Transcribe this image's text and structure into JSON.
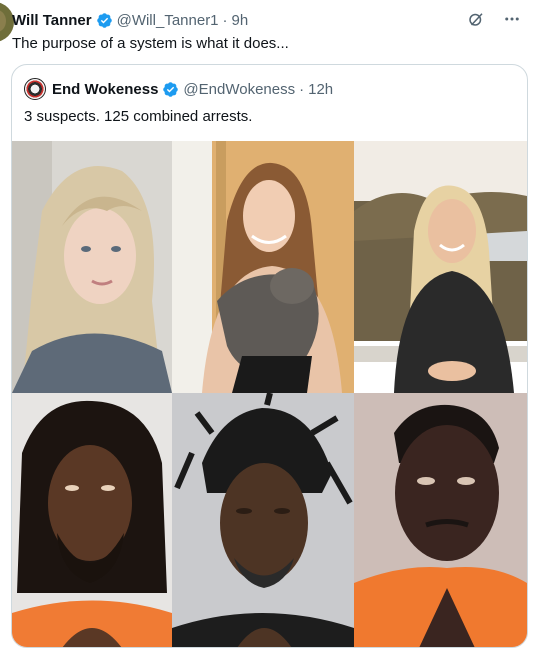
{
  "tweet": {
    "author_name": "Will Tanner",
    "handle": "@Will_Tanner1",
    "separator": "·",
    "time": "9h",
    "text": "The purpose of a system is what it does..."
  },
  "quoted": {
    "author_name": "End Wokeness",
    "handle": "@EndWokeness",
    "separator": "·",
    "time": "12h",
    "text": "3 suspects. 125 combined arrests."
  },
  "icons": {
    "verified": "verified-badge-icon",
    "grok": "grok-icon",
    "more": "more-icon"
  },
  "colors": {
    "verified_blue": "#1d9bf0",
    "text": "#0f1419",
    "muted": "#536471",
    "border": "#cfd9de",
    "prison_orange": "#f0792f"
  },
  "photos": [
    {
      "subject": "woman-blonde-selfie"
    },
    {
      "subject": "woman-holding-cat"
    },
    {
      "subject": "woman-blonde-outdoor"
    },
    {
      "subject": "man-dreadlocks-mugshot"
    },
    {
      "subject": "man-twists-mugshot"
    },
    {
      "subject": "man-orange-jumpsuit-mugshot"
    }
  ]
}
